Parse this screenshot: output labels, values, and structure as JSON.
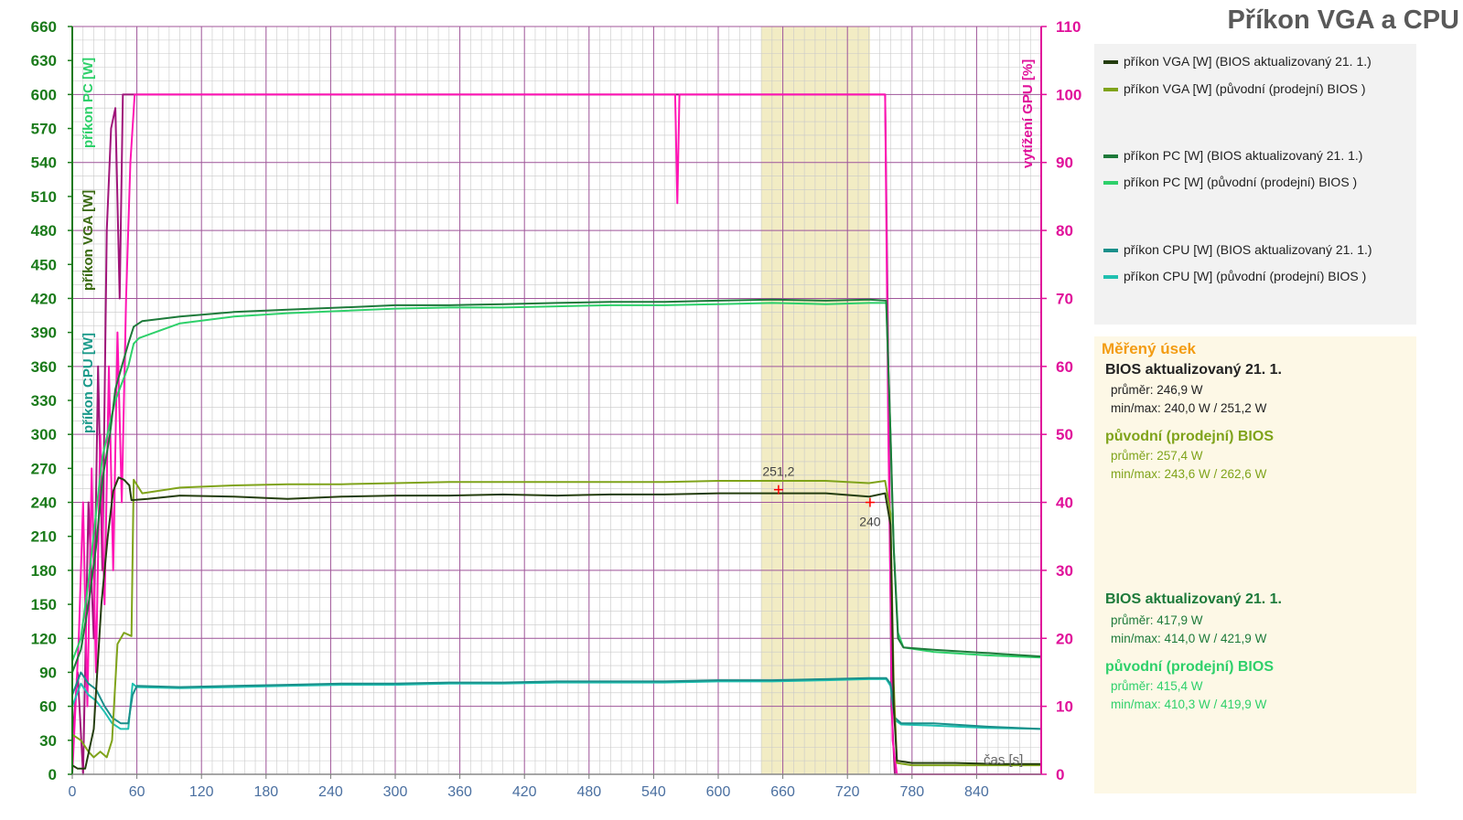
{
  "title": "Příkon VGA a CPU",
  "colors": {
    "vga_new": "#243d0e",
    "vga_old": "#7fa31a",
    "pc_new": "#1d7a3a",
    "pc_old": "#2ed06a",
    "cpu_new": "#1a8f8a",
    "cpu_old": "#20c0b0",
    "gpu_new": "#a0157a",
    "gpu_old": "#ff14b4",
    "left_axis": "#1a7a1a",
    "right_axis": "#e0109a",
    "grid_major": "#a0569a",
    "grid_minor": "#c8c8c8",
    "highlight": "#f2ecc4"
  },
  "legend": [
    {
      "label": "příkon VGA [W] (BIOS aktualizovaný 21. 1.)",
      "color_key": "vga_new"
    },
    {
      "label": "příkon VGA [W] (původní (prodejní) BIOS )",
      "color_key": "vga_old"
    },
    {
      "label": "příkon PC [W] (BIOS aktualizovaný 21. 1.)",
      "color_key": "pc_new"
    },
    {
      "label": "příkon PC [W] (původní (prodejní) BIOS )",
      "color_key": "pc_old"
    },
    {
      "label": "příkon CPU [W] (BIOS aktualizovaný 21. 1.)",
      "color_key": "cpu_new"
    },
    {
      "label": "příkon CPU [W] (původní (prodejní) BIOS )",
      "color_key": "cpu_old"
    }
  ],
  "stats": {
    "heading": "Měřený úsek",
    "vga_new": {
      "title": "BIOS aktualizovaný 21. 1.",
      "avg": "průměr: 246,9 W",
      "minmax": "min/max: 240,0 W / 251,2 W"
    },
    "vga_old": {
      "title": "původní (prodejní) BIOS",
      "avg": "průměr: 257,4 W",
      "minmax": "min/max: 243,6 W / 262,6 W"
    },
    "pc_new": {
      "title": "BIOS aktualizovaný 21. 1.",
      "avg": "průměr: 417,9 W",
      "minmax": "min/max: 414,0 W / 421,9 W"
    },
    "pc_old": {
      "title": "původní (prodejní) BIOS",
      "avg": "průměr: 415,4 W",
      "minmax": "min/max: 410,3 W / 419,9 W"
    }
  },
  "chart_data": {
    "type": "line",
    "x_ticks": [
      0,
      60,
      120,
      180,
      240,
      300,
      360,
      420,
      480,
      540,
      600,
      660,
      720,
      780,
      840
    ],
    "y_left_ticks": [
      0,
      30,
      60,
      90,
      120,
      150,
      180,
      210,
      240,
      270,
      300,
      330,
      360,
      390,
      420,
      450,
      480,
      510,
      540,
      570,
      600,
      630,
      660
    ],
    "y_right_ticks": [
      0,
      10,
      20,
      30,
      40,
      50,
      60,
      70,
      80,
      90,
      100,
      110
    ],
    "xlim": [
      0,
      900
    ],
    "ylim_left": [
      0,
      660
    ],
    "ylim_right": [
      0,
      110
    ],
    "xlabel": "čas [s]",
    "ylabel_left": [
      "příkon CPU [W]",
      "příkon VGA [W]",
      "příkon PC [W]"
    ],
    "ylabel_right": "vytížení GPU [%]",
    "highlight_range": [
      640,
      741
    ],
    "annotations": [
      {
        "x": 656,
        "y": 251.2,
        "text": "251,2"
      },
      {
        "x": 741,
        "y": 240,
        "text": "240"
      }
    ],
    "series": [
      {
        "name": "příkon VGA [W] (BIOS aktualizovaný 21. 1.)",
        "color_key": "vga_new",
        "axis": "left",
        "points": [
          [
            0,
            8
          ],
          [
            5,
            5
          ],
          [
            12,
            5
          ],
          [
            20,
            40
          ],
          [
            27,
            150
          ],
          [
            33,
            210
          ],
          [
            38,
            250
          ],
          [
            43,
            262
          ],
          [
            48,
            260
          ],
          [
            53,
            255
          ],
          [
            55,
            242
          ],
          [
            70,
            243
          ],
          [
            100,
            246
          ],
          [
            150,
            245
          ],
          [
            200,
            243
          ],
          [
            250,
            245
          ],
          [
            300,
            246
          ],
          [
            350,
            246
          ],
          [
            400,
            247
          ],
          [
            450,
            246
          ],
          [
            500,
            247
          ],
          [
            550,
            247
          ],
          [
            600,
            248
          ],
          [
            650,
            248
          ],
          [
            700,
            248
          ],
          [
            740,
            245
          ],
          [
            755,
            248
          ],
          [
            760,
            220
          ],
          [
            763,
            60
          ],
          [
            766,
            12
          ],
          [
            780,
            10
          ],
          [
            820,
            10
          ],
          [
            860,
            9
          ],
          [
            900,
            9
          ]
        ]
      },
      {
        "name": "příkon VGA [W] (původní (prodejní) BIOS )",
        "color_key": "vga_old",
        "axis": "left",
        "points": [
          [
            0,
            35
          ],
          [
            8,
            30
          ],
          [
            15,
            20
          ],
          [
            20,
            15
          ],
          [
            26,
            20
          ],
          [
            32,
            15
          ],
          [
            37,
            30
          ],
          [
            42,
            115
          ],
          [
            48,
            125
          ],
          [
            55,
            122
          ],
          [
            57,
            260
          ],
          [
            65,
            248
          ],
          [
            100,
            253
          ],
          [
            150,
            255
          ],
          [
            200,
            256
          ],
          [
            250,
            256
          ],
          [
            300,
            257
          ],
          [
            350,
            258
          ],
          [
            400,
            258
          ],
          [
            450,
            258
          ],
          [
            500,
            258
          ],
          [
            550,
            258
          ],
          [
            600,
            259
          ],
          [
            650,
            259
          ],
          [
            700,
            259
          ],
          [
            740,
            257
          ],
          [
            755,
            259
          ],
          [
            760,
            230
          ],
          [
            763,
            80
          ],
          [
            766,
            10
          ],
          [
            780,
            8
          ],
          [
            820,
            8
          ],
          [
            860,
            8
          ],
          [
            900,
            8
          ]
        ]
      },
      {
        "name": "příkon PC [W] (BIOS aktualizovaný 21. 1.)",
        "color_key": "pc_new",
        "axis": "left",
        "points": [
          [
            0,
            90
          ],
          [
            8,
            110
          ],
          [
            15,
            150
          ],
          [
            22,
            200
          ],
          [
            28,
            260
          ],
          [
            35,
            300
          ],
          [
            40,
            340
          ],
          [
            46,
            360
          ],
          [
            52,
            380
          ],
          [
            57,
            395
          ],
          [
            65,
            400
          ],
          [
            100,
            404
          ],
          [
            150,
            408
          ],
          [
            200,
            410
          ],
          [
            250,
            412
          ],
          [
            300,
            414
          ],
          [
            350,
            414
          ],
          [
            400,
            415
          ],
          [
            450,
            416
          ],
          [
            500,
            417
          ],
          [
            550,
            417
          ],
          [
            600,
            418
          ],
          [
            650,
            419
          ],
          [
            700,
            418
          ],
          [
            740,
            419
          ],
          [
            756,
            418
          ],
          [
            760,
            300
          ],
          [
            763,
            200
          ],
          [
            767,
            120
          ],
          [
            772,
            112
          ],
          [
            800,
            110
          ],
          [
            850,
            107
          ],
          [
            900,
            104
          ]
        ]
      },
      {
        "name": "příkon PC [W] (původní (prodejní) BIOS )",
        "color_key": "pc_old",
        "axis": "left",
        "points": [
          [
            0,
            100
          ],
          [
            8,
            120
          ],
          [
            15,
            170
          ],
          [
            22,
            230
          ],
          [
            28,
            280
          ],
          [
            35,
            310
          ],
          [
            40,
            330
          ],
          [
            46,
            345
          ],
          [
            52,
            360
          ],
          [
            57,
            380
          ],
          [
            62,
            385
          ],
          [
            100,
            398
          ],
          [
            150,
            404
          ],
          [
            200,
            407
          ],
          [
            250,
            409
          ],
          [
            300,
            411
          ],
          [
            350,
            412
          ],
          [
            400,
            412
          ],
          [
            450,
            413
          ],
          [
            500,
            414
          ],
          [
            550,
            414
          ],
          [
            600,
            415
          ],
          [
            650,
            416
          ],
          [
            700,
            415
          ],
          [
            740,
            416
          ],
          [
            756,
            416
          ],
          [
            760,
            300
          ],
          [
            763,
            200
          ],
          [
            767,
            125
          ],
          [
            772,
            112
          ],
          [
            800,
            108
          ],
          [
            850,
            105
          ],
          [
            900,
            103
          ]
        ]
      },
      {
        "name": "příkon CPU [W] (BIOS aktualizovaný 21. 1.)",
        "color_key": "cpu_new",
        "axis": "left",
        "points": [
          [
            0,
            70
          ],
          [
            8,
            90
          ],
          [
            15,
            80
          ],
          [
            22,
            75
          ],
          [
            30,
            60
          ],
          [
            37,
            50
          ],
          [
            45,
            45
          ],
          [
            52,
            45
          ],
          [
            56,
            70
          ],
          [
            60,
            78
          ],
          [
            100,
            77
          ],
          [
            150,
            78
          ],
          [
            200,
            79
          ],
          [
            250,
            80
          ],
          [
            300,
            80
          ],
          [
            350,
            81
          ],
          [
            400,
            81
          ],
          [
            450,
            82
          ],
          [
            500,
            82
          ],
          [
            550,
            82
          ],
          [
            600,
            83
          ],
          [
            650,
            83
          ],
          [
            700,
            84
          ],
          [
            740,
            85
          ],
          [
            756,
            85
          ],
          [
            760,
            80
          ],
          [
            764,
            50
          ],
          [
            770,
            45
          ],
          [
            800,
            45
          ],
          [
            850,
            42
          ],
          [
            900,
            40
          ]
        ]
      },
      {
        "name": "příkon CPU [W] (původní (prodejní) BIOS )",
        "color_key": "cpu_old",
        "axis": "left",
        "points": [
          [
            0,
            60
          ],
          [
            8,
            80
          ],
          [
            15,
            70
          ],
          [
            22,
            65
          ],
          [
            30,
            55
          ],
          [
            37,
            45
          ],
          [
            45,
            40
          ],
          [
            52,
            40
          ],
          [
            56,
            80
          ],
          [
            60,
            77
          ],
          [
            100,
            76
          ],
          [
            150,
            77
          ],
          [
            200,
            78
          ],
          [
            250,
            79
          ],
          [
            300,
            79
          ],
          [
            350,
            80
          ],
          [
            400,
            80
          ],
          [
            450,
            81
          ],
          [
            500,
            81
          ],
          [
            550,
            81
          ],
          [
            600,
            82
          ],
          [
            650,
            82
          ],
          [
            700,
            83
          ],
          [
            740,
            84
          ],
          [
            756,
            84
          ],
          [
            760,
            78
          ],
          [
            764,
            48
          ],
          [
            770,
            44
          ],
          [
            800,
            43
          ],
          [
            850,
            41
          ],
          [
            900,
            40
          ]
        ]
      },
      {
        "name": "vytížení GPU [%] (BIOS aktualizovaný 21. 1.)",
        "color_key": "gpu_new",
        "axis": "right",
        "points": [
          [
            0,
            5
          ],
          [
            5,
            15
          ],
          [
            10,
            0
          ],
          [
            15,
            40
          ],
          [
            20,
            20
          ],
          [
            24,
            60
          ],
          [
            28,
            30
          ],
          [
            32,
            80
          ],
          [
            36,
            95
          ],
          [
            40,
            98
          ],
          [
            44,
            70
          ],
          [
            47,
            100
          ],
          [
            55,
            100
          ],
          [
            100,
            100
          ],
          [
            200,
            100
          ],
          [
            300,
            100
          ],
          [
            400,
            100
          ],
          [
            500,
            100
          ],
          [
            600,
            100
          ],
          [
            700,
            100
          ],
          [
            755,
            100
          ],
          [
            758,
            60
          ],
          [
            761,
            10
          ],
          [
            764,
            0
          ],
          [
            900,
            0
          ]
        ]
      },
      {
        "name": "vytížení GPU [%] (původní (prodejní) BIOS )",
        "color_key": "gpu_old",
        "axis": "right",
        "points": [
          [
            0,
            0
          ],
          [
            6,
            20
          ],
          [
            10,
            40
          ],
          [
            14,
            10
          ],
          [
            18,
            45
          ],
          [
            22,
            15
          ],
          [
            26,
            50
          ],
          [
            30,
            25
          ],
          [
            34,
            60
          ],
          [
            38,
            30
          ],
          [
            42,
            65
          ],
          [
            46,
            40
          ],
          [
            50,
            70
          ],
          [
            54,
            90
          ],
          [
            58,
            100
          ],
          [
            100,
            100
          ],
          [
            200,
            100
          ],
          [
            300,
            100
          ],
          [
            400,
            100
          ],
          [
            500,
            100
          ],
          [
            540,
            100
          ],
          [
            560,
            100
          ],
          [
            562,
            84
          ],
          [
            564,
            100
          ],
          [
            600,
            100
          ],
          [
            700,
            100
          ],
          [
            755,
            100
          ],
          [
            758,
            50
          ],
          [
            762,
            5
          ],
          [
            766,
            0
          ],
          [
            840,
            0
          ],
          [
            900,
            0
          ]
        ]
      }
    ]
  }
}
